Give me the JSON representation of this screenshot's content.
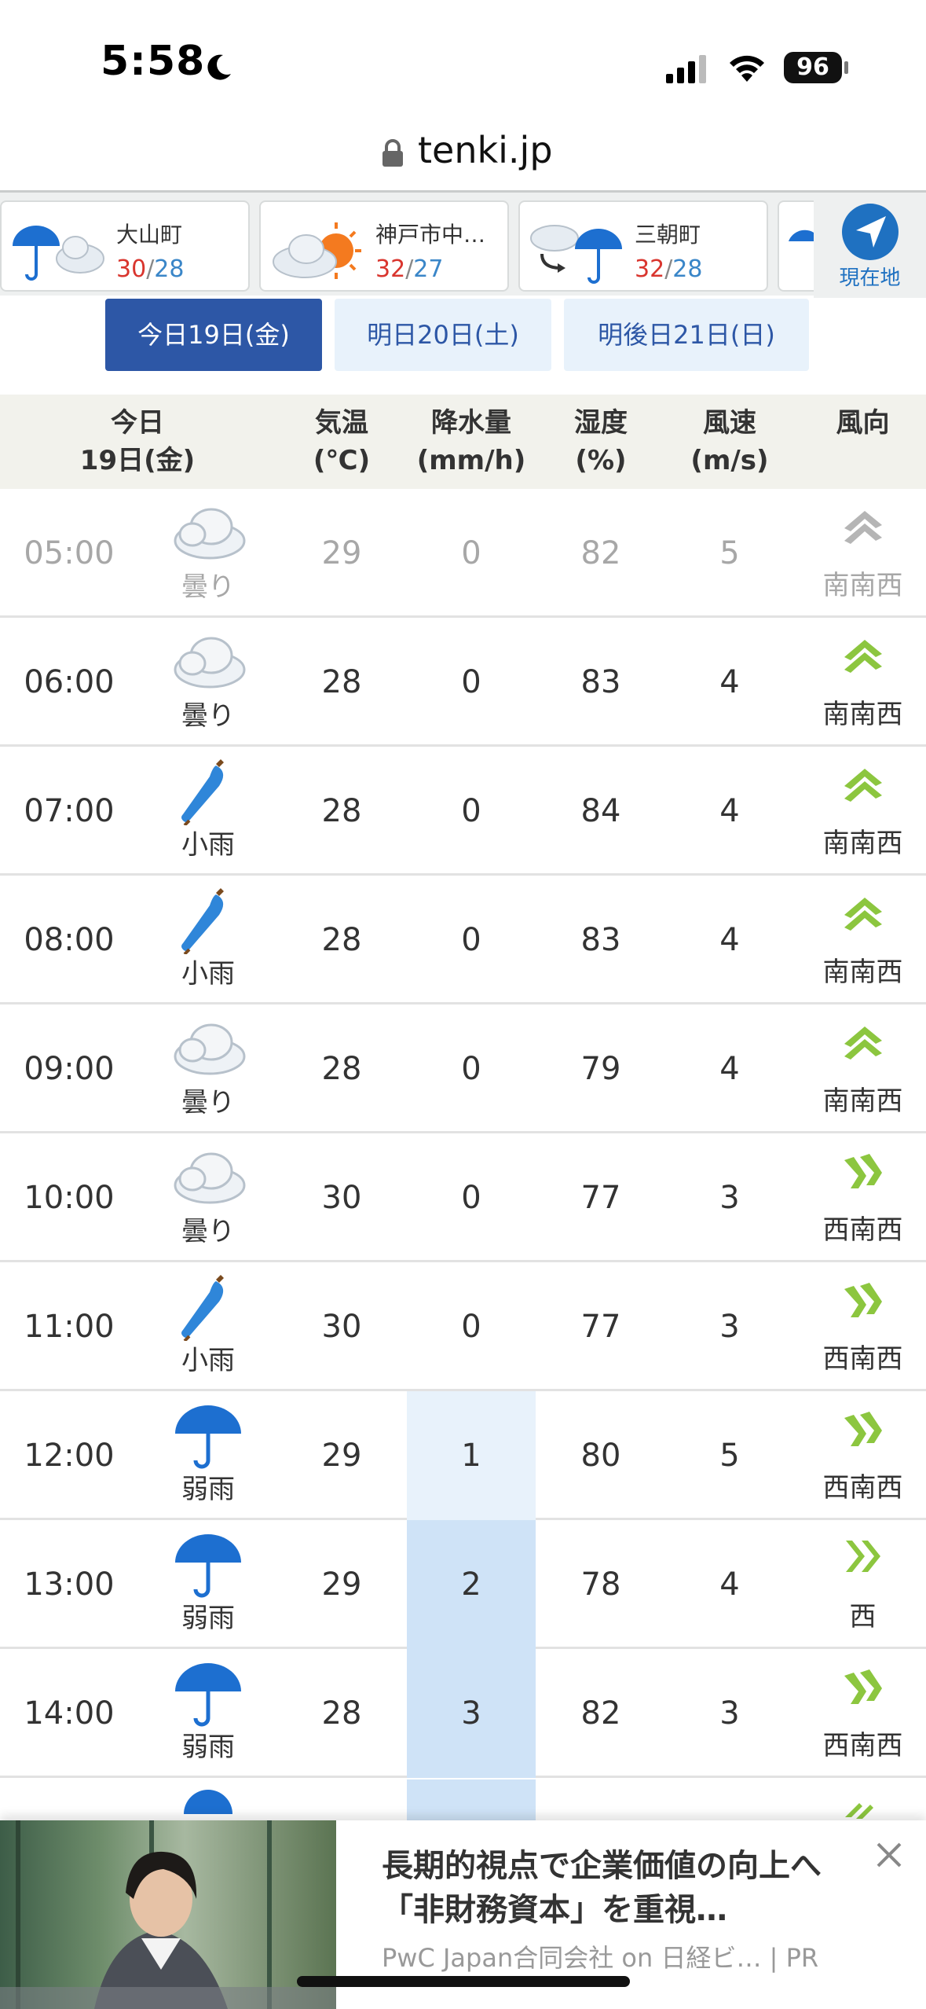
{
  "status_bar": {
    "time": "5:58",
    "battery": "96"
  },
  "url_bar": {
    "domain": "tenki.jp"
  },
  "locations": [
    {
      "name": "大山町",
      "max": "30",
      "min": "28",
      "icon": "rain-cloud-icon"
    },
    {
      "name": "神戸市中…",
      "max": "32",
      "min": "27",
      "icon": "cloud-sun-icon"
    },
    {
      "name": "三朝町",
      "max": "32",
      "min": "28",
      "icon": "cloud-then-rain-icon"
    }
  ],
  "temp_sep": "/",
  "current_location": {
    "label": "現在地"
  },
  "tabs": [
    {
      "label": "今日19日(金)",
      "active": true
    },
    {
      "label": "明日20日(土)",
      "active": false
    },
    {
      "label": "明後日21日(日)",
      "active": false
    }
  ],
  "table_header": {
    "day_line1": "今日",
    "day_line2": "19日(金)",
    "temp_line1": "気温",
    "temp_line2": "(℃)",
    "precip_line1": "降水量",
    "precip_line2": "(mm/h)",
    "humidity_line1": "湿度",
    "humidity_line2": "(%)",
    "wind_speed_line1": "風速",
    "wind_speed_line2": "(m/s)",
    "wind_dir_line1": "風向"
  },
  "rows": [
    {
      "time": "05:00",
      "weather": "曇り",
      "icon": "cloud-icon",
      "temp": "29",
      "precip": "0",
      "humidity": "82",
      "wind_speed": "5",
      "wind_dir": "南南西",
      "past": true
    },
    {
      "time": "06:00",
      "weather": "曇り",
      "icon": "cloud-icon",
      "temp": "28",
      "precip": "0",
      "humidity": "83",
      "wind_speed": "4",
      "wind_dir": "南南西"
    },
    {
      "time": "07:00",
      "weather": "小雨",
      "icon": "closed-umbrella-icon",
      "temp": "28",
      "precip": "0",
      "humidity": "84",
      "wind_speed": "4",
      "wind_dir": "南南西"
    },
    {
      "time": "08:00",
      "weather": "小雨",
      "icon": "closed-umbrella-icon",
      "temp": "28",
      "precip": "0",
      "humidity": "83",
      "wind_speed": "4",
      "wind_dir": "南南西"
    },
    {
      "time": "09:00",
      "weather": "曇り",
      "icon": "cloud-icon",
      "temp": "28",
      "precip": "0",
      "humidity": "79",
      "wind_speed": "4",
      "wind_dir": "南南西"
    },
    {
      "time": "10:00",
      "weather": "曇り",
      "icon": "cloud-icon",
      "temp": "30",
      "precip": "0",
      "humidity": "77",
      "wind_speed": "3",
      "wind_dir": "西南西"
    },
    {
      "time": "11:00",
      "weather": "小雨",
      "icon": "closed-umbrella-icon",
      "temp": "30",
      "precip": "0",
      "humidity": "77",
      "wind_speed": "3",
      "wind_dir": "西南西"
    },
    {
      "time": "12:00",
      "weather": "弱雨",
      "icon": "umbrella-icon",
      "temp": "29",
      "precip": "1",
      "humidity": "80",
      "wind_speed": "5",
      "wind_dir": "西南西"
    },
    {
      "time": "13:00",
      "weather": "弱雨",
      "icon": "umbrella-icon",
      "temp": "29",
      "precip": "2",
      "humidity": "78",
      "wind_speed": "4",
      "wind_dir": "西"
    },
    {
      "time": "14:00",
      "weather": "弱雨",
      "icon": "umbrella-icon",
      "temp": "28",
      "precip": "3",
      "humidity": "82",
      "wind_speed": "3",
      "wind_dir": "西南西"
    }
  ],
  "ad": {
    "headline": "長期的視点で企業価値の向上へ　「非財務資本」を重視…",
    "source": "PwC Japan合同会社 on 日経ビ…",
    "pr": "| PR"
  },
  "colors": {
    "accent": "#2d57a6",
    "temp_max": "#d9352e",
    "temp_min": "#3a86c8",
    "wind_arrow": "#8cc63f",
    "precip_light": "#e8f2fb",
    "precip_mid": "#cfe3f7"
  }
}
